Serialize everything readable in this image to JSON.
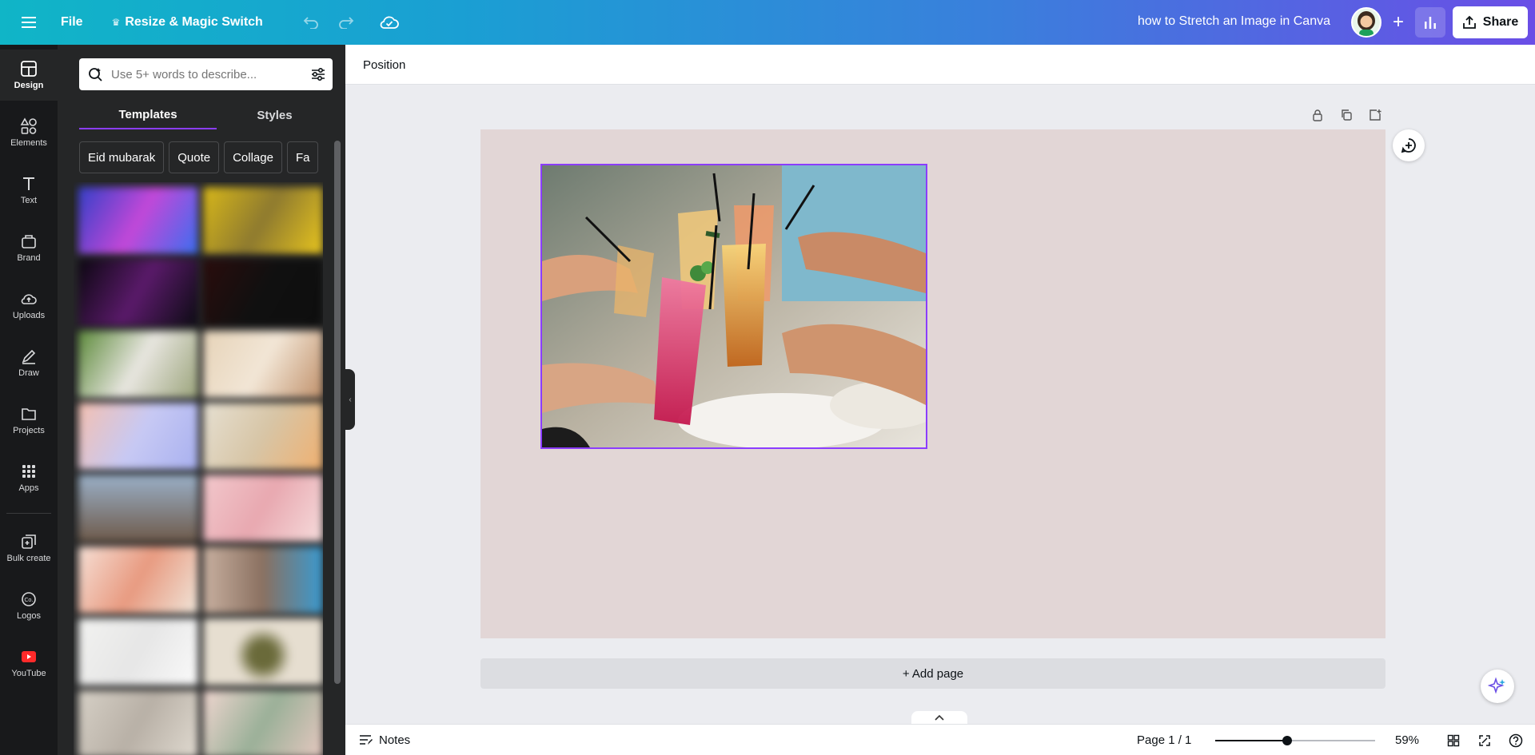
{
  "topbar": {
    "file_label": "File",
    "resize_label": "Resize & Magic Switch",
    "doc_title": "how to Stretch an Image in Canva",
    "share_label": "Share"
  },
  "rail": {
    "items": [
      {
        "label": "Design",
        "icon": "layout-icon"
      },
      {
        "label": "Elements",
        "icon": "shapes-icon"
      },
      {
        "label": "Text",
        "icon": "text-icon"
      },
      {
        "label": "Brand",
        "icon": "brand-icon"
      },
      {
        "label": "Uploads",
        "icon": "cloud-upload-icon"
      },
      {
        "label": "Draw",
        "icon": "pen-icon"
      },
      {
        "label": "Projects",
        "icon": "folder-icon"
      },
      {
        "label": "Apps",
        "icon": "grid-icon"
      },
      {
        "label": "Bulk create",
        "icon": "bulk-create-icon"
      },
      {
        "label": "Logos",
        "icon": "logo-icon"
      },
      {
        "label": "YouTube",
        "icon": "youtube-icon"
      }
    ]
  },
  "panel": {
    "search_placeholder": "Use 5+ words to describe...",
    "tabs": [
      "Templates",
      "Styles"
    ],
    "chips": [
      "Eid mubarak",
      "Quote",
      "Collage",
      "Fa"
    ]
  },
  "toolbar": {
    "position_label": "Position"
  },
  "canvas": {
    "add_page_label": "+ Add page"
  },
  "bottombar": {
    "notes_label": "Notes",
    "page_indicator": "Page 1 / 1",
    "zoom_value": "59%",
    "zoom_fraction": 0.59
  },
  "colors": {
    "accent": "#8b3dff",
    "rail_bg": "#18191b",
    "panel_bg": "#252627",
    "page_bg": "#e2d6d6"
  }
}
